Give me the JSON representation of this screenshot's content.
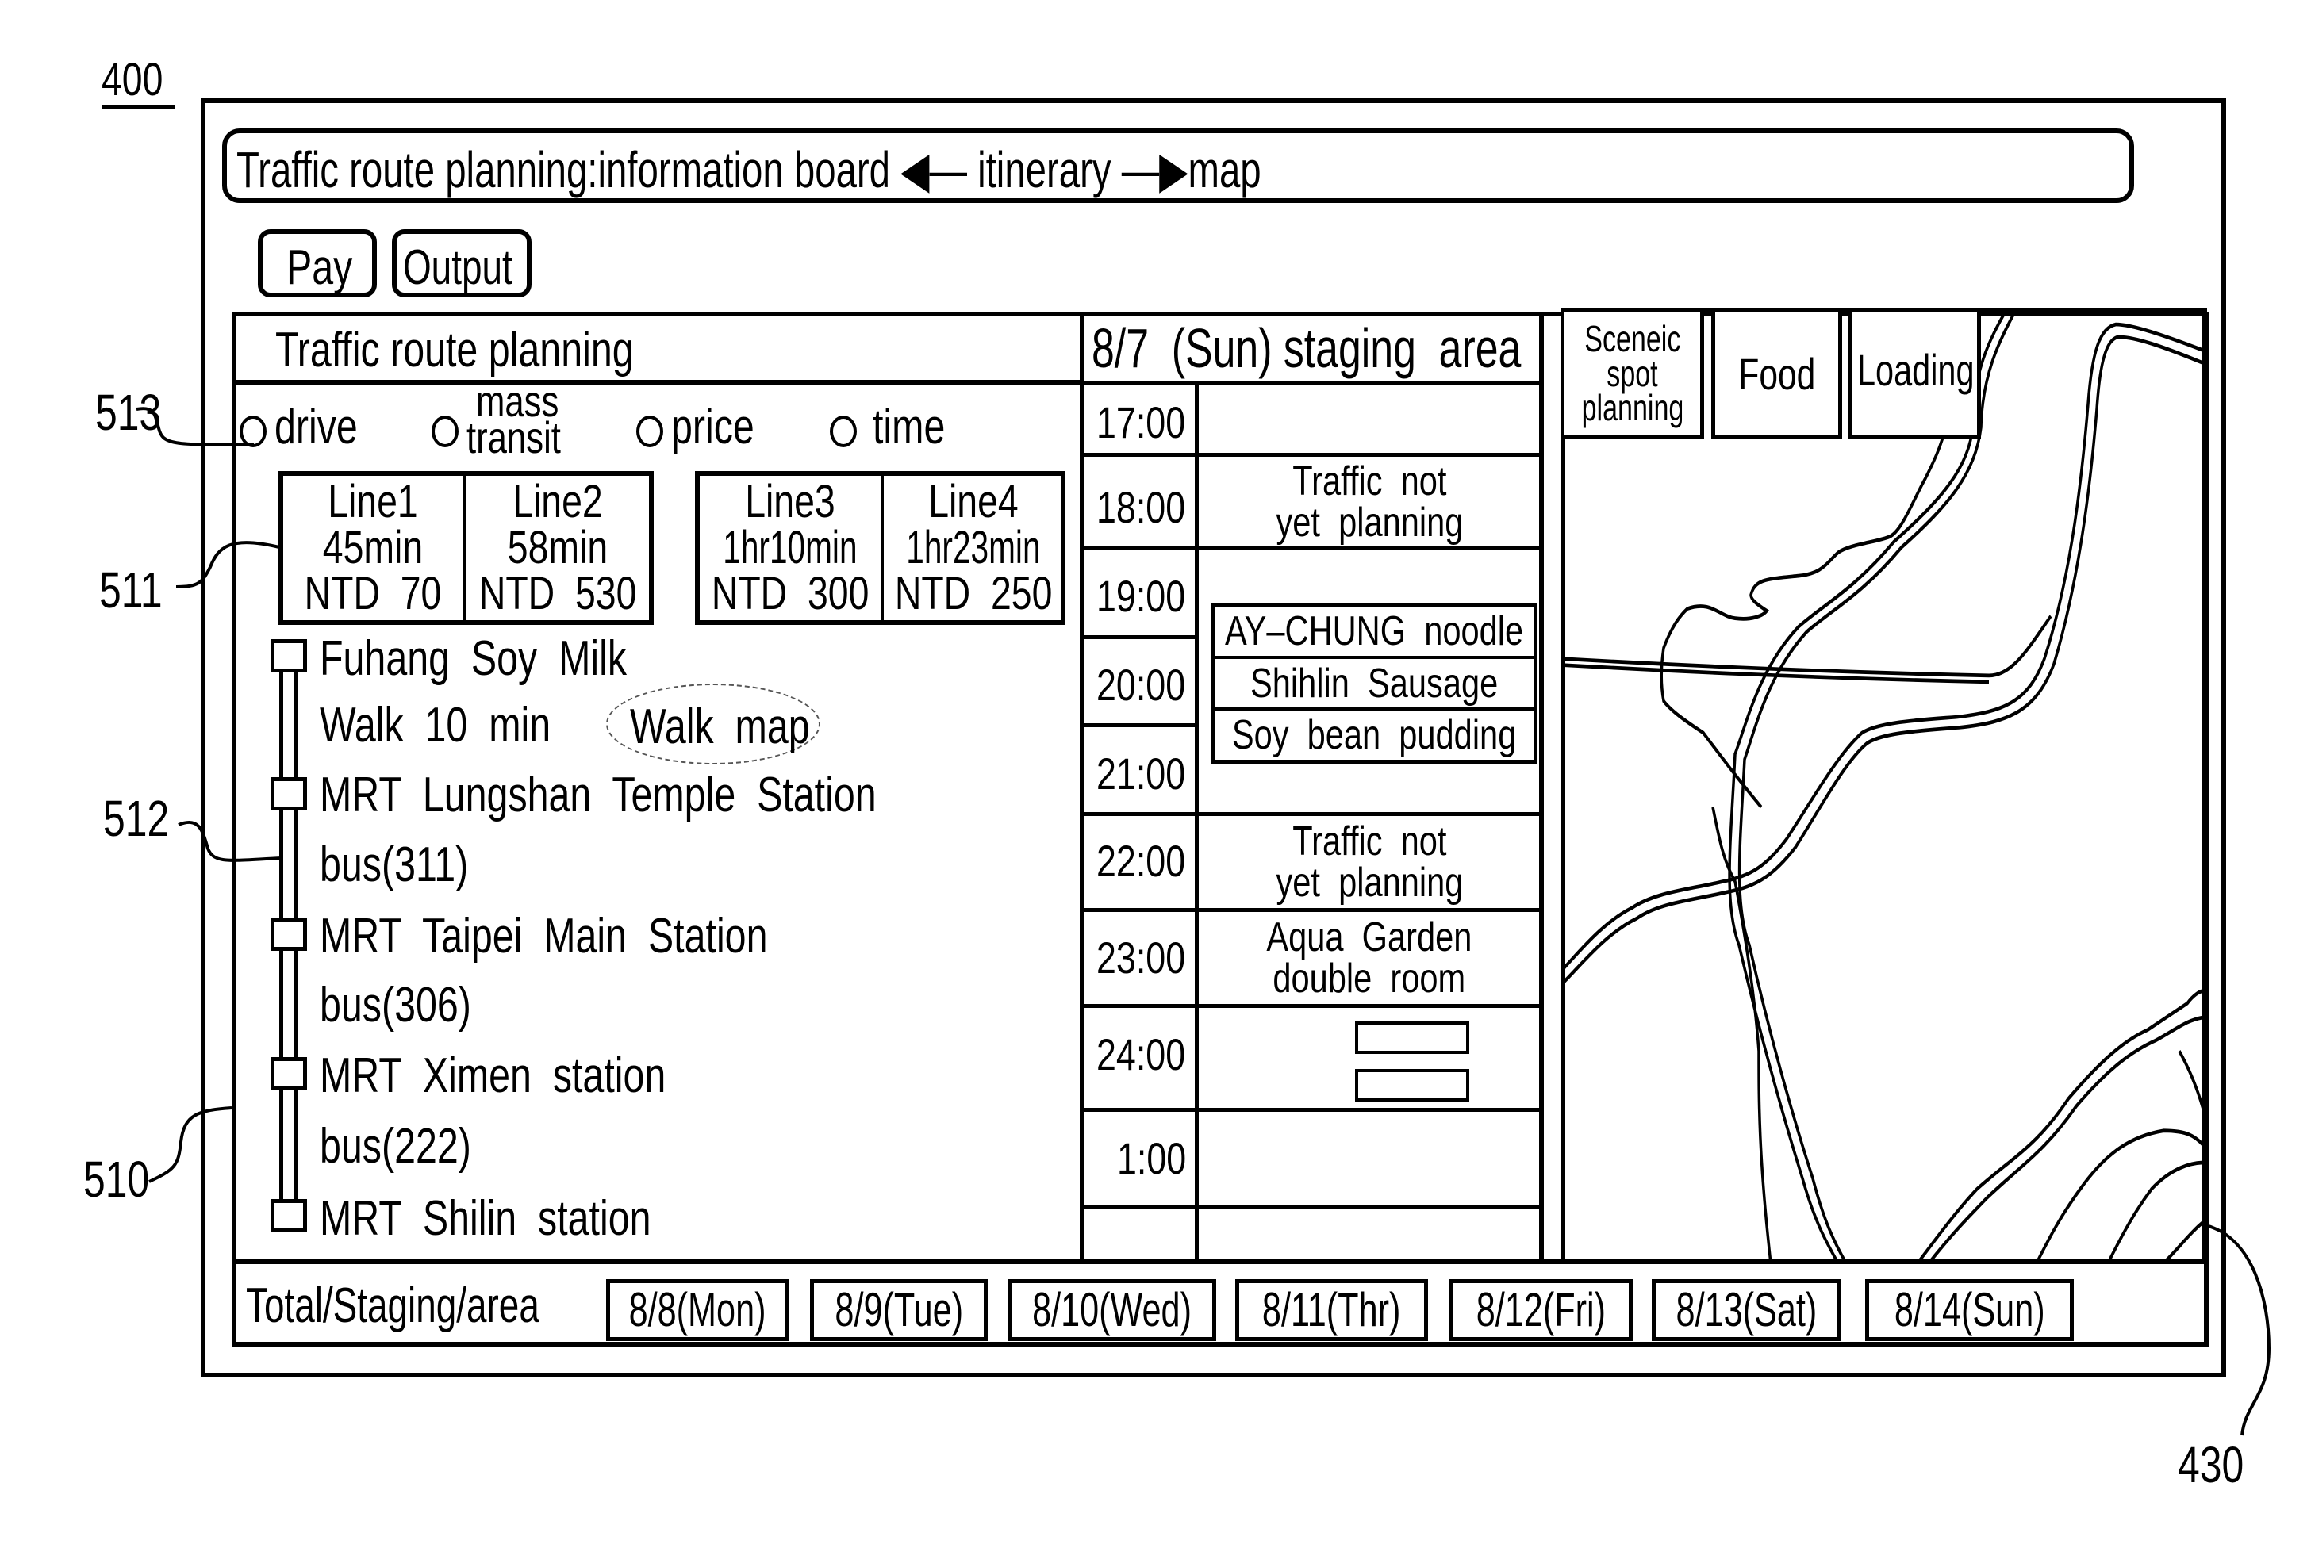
{
  "figure": {
    "ref_main": "400",
    "ref_panel": "510",
    "ref_lines": "511",
    "ref_itinerary": "512",
    "ref_options": "513",
    "ref_map": "430"
  },
  "header": {
    "title": "Traffic route planning:information board ← itinerary → map",
    "title_parts": {
      "prefix": "Traffic route planning:information board",
      "left_arrow_icon": "arrow-left-icon",
      "middle": "itinerary",
      "right_arrow_icon": "arrow-right-icon",
      "suffix": "map"
    }
  },
  "toolbar": {
    "pay_label": "Pay",
    "output_label": "Output"
  },
  "route_panel": {
    "title": "Traffic route planning",
    "options": [
      {
        "label": "drive",
        "selected": false
      },
      {
        "label_line1": "mass",
        "label_line2": "transit",
        "label": "mass transit",
        "selected": false
      },
      {
        "label": "price",
        "selected": false
      },
      {
        "label": "time",
        "selected": false
      }
    ],
    "lines": [
      {
        "name": "Line1",
        "duration": "45min",
        "price": "NTD  70"
      },
      {
        "name": "Line2",
        "duration": "58min",
        "price": "NTD  530"
      },
      {
        "name": "Line3",
        "duration": "1hr10min",
        "price": "NTD  300"
      },
      {
        "name": "Line4",
        "duration": "1hr23min",
        "price": "NTD  250"
      }
    ],
    "itinerary": [
      {
        "type": "stop",
        "label": "Fuhang  Soy  Milk"
      },
      {
        "type": "leg",
        "label": "Walk  10  min",
        "link": "Walk  map"
      },
      {
        "type": "stop",
        "label": "MRT  Lungshan  Temple  Station"
      },
      {
        "type": "leg",
        "label": "bus(311)"
      },
      {
        "type": "stop",
        "label": "MRT  Taipei  Main  Station"
      },
      {
        "type": "leg",
        "label": "bus(306)"
      },
      {
        "type": "stop",
        "label": "MRT  Ximen  station"
      },
      {
        "type": "leg",
        "label": "bus(222)"
      },
      {
        "type": "stop",
        "label": "MRT  Shilin  station"
      }
    ]
  },
  "schedule": {
    "title": "8/7  (Sun) staging  area",
    "times": [
      "17:00",
      "18:00",
      "19:00",
      "20:00",
      "21:00",
      "22:00",
      "23:00",
      "24:00",
      "1:00",
      ""
    ],
    "entries": {
      "slot_18_line1": "Traffic  not",
      "slot_18_line2": "yet  planning",
      "food_items": [
        "AY–CHUNG  noodle",
        "Shihlin  Sausage",
        "Soy  bean  pudding"
      ],
      "slot_22_line1": "Traffic  not",
      "slot_22_line2": "yet  planning",
      "slot_23_line1": "Aqua  Garden",
      "slot_23_line2": "double  room"
    }
  },
  "map": {
    "tabs": [
      {
        "lines": [
          "Sceneic",
          "spot",
          "planning"
        ],
        "label": "Sceneic spot planning"
      },
      {
        "lines": [
          "Food"
        ],
        "label": "Food"
      },
      {
        "lines": [
          "Loading"
        ],
        "label": "Loading"
      }
    ]
  },
  "footer": {
    "label": "Total/Staging/area",
    "dates": [
      "8/8(Mon)",
      "8/9(Tue)",
      "8/10(Wed)",
      "8/11(Thr)",
      "8/12(Fri)",
      "8/13(Sat)",
      "8/14(Sun)"
    ]
  }
}
